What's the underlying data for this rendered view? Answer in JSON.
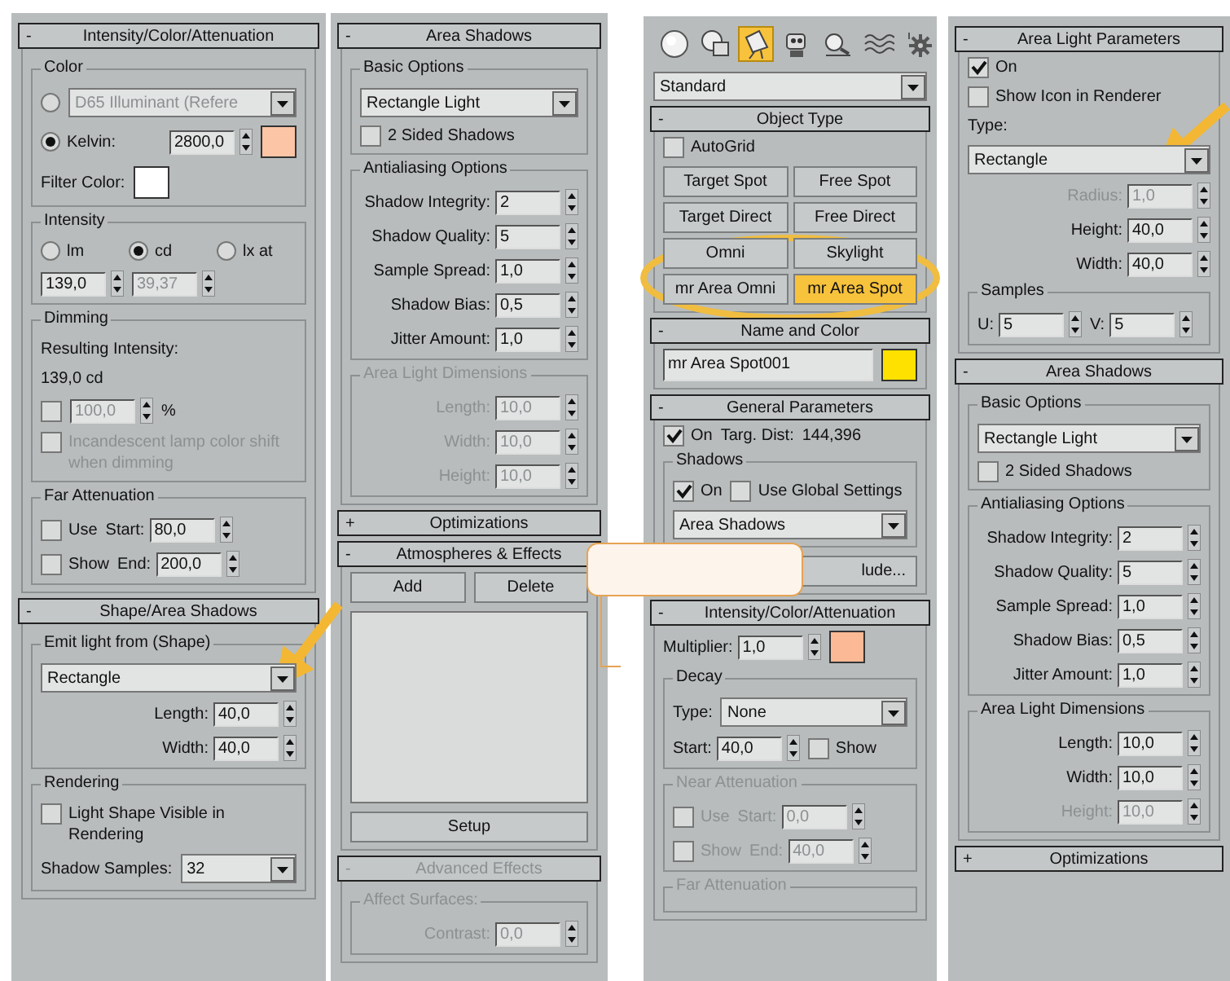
{
  "columns": [
    {
      "items": [
        {
          "kind": "rollout",
          "toggle": "-",
          "title": "Intensity/Color/Attenuation",
          "items": [
            {
              "kind": "group",
              "title": "Color",
              "items": [
                {
                  "kind": "row",
                  "items": [
                    {
                      "kind": "radio",
                      "selected": false,
                      "disabled": true
                    },
                    {
                      "kind": "dropdown",
                      "value": "D65 Illuminant (Refere",
                      "disabled": true
                    }
                  ]
                },
                {
                  "kind": "row",
                  "items": [
                    {
                      "kind": "radio",
                      "label": "Kelvin:",
                      "selected": true
                    },
                    {
                      "kind": "spinner",
                      "value": "2800,0"
                    },
                    {
                      "kind": "color",
                      "color": "#fbc5a6"
                    }
                  ]
                },
                {
                  "kind": "row",
                  "items": [
                    {
                      "kind": "text",
                      "text": "Filter Color:"
                    },
                    {
                      "kind": "color",
                      "color": "#ffffff"
                    }
                  ]
                }
              ]
            },
            {
              "kind": "group",
              "title": "Intensity",
              "items": [
                {
                  "kind": "row",
                  "items": [
                    {
                      "kind": "radio",
                      "label": "lm",
                      "selected": false
                    },
                    {
                      "kind": "radio",
                      "label": "cd",
                      "selected": true
                    },
                    {
                      "kind": "radio",
                      "label": "lx at",
                      "selected": false
                    }
                  ]
                },
                {
                  "kind": "row",
                  "items": [
                    {
                      "kind": "spinner",
                      "value": "139,0"
                    },
                    {
                      "kind": "spinner",
                      "value": "39,37",
                      "disabled": true
                    }
                  ]
                }
              ]
            },
            {
              "kind": "group",
              "title": "Dimming",
              "items": [
                {
                  "kind": "text",
                  "text": "Resulting Intensity:"
                },
                {
                  "kind": "text",
                  "text": "139,0 cd"
                },
                {
                  "kind": "row",
                  "items": [
                    {
                      "kind": "checkbox",
                      "checked": false
                    },
                    {
                      "kind": "spinner",
                      "value": "100,0",
                      "disabled": true
                    },
                    {
                      "kind": "text",
                      "text": "%"
                    }
                  ]
                },
                {
                  "kind": "checkbox",
                  "label": "Incandescent lamp color shift when dimming",
                  "checked": false,
                  "disabled": true
                }
              ]
            },
            {
              "kind": "group",
              "title": "Far Attenuation",
              "items": [
                {
                  "kind": "row",
                  "items": [
                    {
                      "kind": "checkbox",
                      "label": "Use",
                      "checked": false
                    },
                    {
                      "kind": "spinner",
                      "label": "Start:",
                      "value": "80,0"
                    }
                  ]
                },
                {
                  "kind": "row",
                  "items": [
                    {
                      "kind": "checkbox",
                      "label": "Show",
                      "checked": false
                    },
                    {
                      "kind": "spinner",
                      "label": "End:",
                      "value": "200,0"
                    }
                  ]
                }
              ]
            }
          ]
        },
        {
          "kind": "rollout",
          "toggle": "-",
          "title": "Shape/Area Shadows",
          "items": [
            {
              "kind": "group",
              "title": "Emit light from (Shape)",
              "items": [
                {
                  "kind": "dropdown",
                  "value": "Rectangle"
                },
                {
                  "kind": "spinner",
                  "label": "Length:",
                  "value": "40,0"
                },
                {
                  "kind": "spinner",
                  "label": "Width:",
                  "value": "40,0"
                }
              ]
            },
            {
              "kind": "group",
              "title": "Rendering",
              "items": [
                {
                  "kind": "checkbox",
                  "label": "Light Shape Visible in Rendering",
                  "checked": false
                },
                {
                  "kind": "row",
                  "items": [
                    {
                      "kind": "text",
                      "text": "Shadow Samples:"
                    },
                    {
                      "kind": "dropdown",
                      "value": "32"
                    }
                  ]
                }
              ]
            }
          ]
        }
      ]
    },
    {
      "items": [
        {
          "kind": "rollout",
          "toggle": "-",
          "title": "Area Shadows",
          "items": [
            {
              "kind": "group",
              "title": "Basic Options",
              "items": [
                {
                  "kind": "dropdown",
                  "value": "Rectangle Light"
                },
                {
                  "kind": "checkbox",
                  "label": "2 Sided Shadows",
                  "checked": false
                }
              ]
            },
            {
              "kind": "group",
              "title": "Antialiasing Options",
              "items": [
                {
                  "kind": "spinner",
                  "label": "Shadow Integrity:",
                  "value": "2"
                },
                {
                  "kind": "spinner",
                  "label": "Shadow Quality:",
                  "value": "5"
                },
                {
                  "kind": "spacer"
                },
                {
                  "kind": "spinner",
                  "label": "Sample Spread:",
                  "value": "1,0"
                },
                {
                  "kind": "spinner",
                  "label": "Shadow Bias:",
                  "value": "0,5"
                },
                {
                  "kind": "spinner",
                  "label": "Jitter Amount:",
                  "value": "1,0"
                }
              ]
            },
            {
              "kind": "group",
              "title": "Area Light Dimensions",
              "disabled": true,
              "items": [
                {
                  "kind": "spinner",
                  "label": "Length:",
                  "value": "10,0"
                },
                {
                  "kind": "spinner",
                  "label": "Width:",
                  "value": "10,0"
                },
                {
                  "kind": "spinner",
                  "label": "Height:",
                  "value": "10,0"
                }
              ]
            }
          ]
        },
        {
          "kind": "rollout",
          "toggle": "+",
          "title": "Optimizations"
        },
        {
          "kind": "rollout",
          "toggle": "-",
          "title": "Atmospheres & Effects",
          "items": [
            {
              "kind": "row",
              "items": [
                {
                  "kind": "button",
                  "label": "Add",
                  "selected": false
                },
                {
                  "kind": "button",
                  "label": "Delete",
                  "selected": false
                }
              ]
            },
            {
              "kind": "listbox"
            },
            {
              "kind": "button",
              "label": "Setup",
              "selected": false
            }
          ]
        },
        {
          "kind": "rollout",
          "toggle": "-",
          "title": "Advanced Effects",
          "disabled": true,
          "items": [
            {
              "kind": "group",
              "title": "Affect Surfaces:",
              "items": [
                {
                  "kind": "spinner",
                  "label": "Contrast:",
                  "value": "0,0"
                }
              ]
            }
          ]
        }
      ]
    },
    {
      "items": [
        {
          "kind": "toolbar",
          "buttons": [
            {
              "selected": false
            },
            {
              "selected": false
            },
            {
              "selected": true
            },
            {
              "selected": false
            },
            {
              "selected": false
            },
            {
              "selected": false
            },
            {
              "selected": false
            }
          ]
        },
        {
          "kind": "dropdown",
          "value": "Standard"
        },
        {
          "kind": "rollout",
          "toggle": "-",
          "title": "Object Type",
          "items": [
            {
              "kind": "checkbox",
              "label": "AutoGrid",
              "checked": false
            },
            {
              "kind": "grid",
              "items": [
                {
                  "kind": "button",
                  "label": "Target Spot",
                  "selected": false
                },
                {
                  "kind": "button",
                  "label": "Free Spot",
                  "selected": false
                },
                {
                  "kind": "button",
                  "label": "Target Direct",
                  "selected": false
                },
                {
                  "kind": "button",
                  "label": "Free Direct",
                  "selected": false
                },
                {
                  "kind": "button",
                  "label": "Omni",
                  "selected": false
                },
                {
                  "kind": "button",
                  "label": "Skylight",
                  "selected": false
                },
                {
                  "kind": "button",
                  "label": "mr Area Omni",
                  "selected": false
                },
                {
                  "kind": "button",
                  "label": "mr Area Spot",
                  "selected": true
                }
              ]
            }
          ]
        },
        {
          "kind": "rollout",
          "toggle": "-",
          "title": "Name and Color",
          "items": [
            {
              "kind": "row",
              "items": [
                {
                  "kind": "input",
                  "value": "mr Area Spot001"
                },
                {
                  "kind": "color",
                  "color": "#ffe100"
                }
              ]
            }
          ]
        },
        {
          "kind": "rollout",
          "toggle": "-",
          "title": "General Parameters",
          "items": [
            {
              "kind": "row",
              "items": [
                {
                  "kind": "checkbox",
                  "label": "On",
                  "checked": true
                },
                {
                  "kind": "text",
                  "text": "Targ. Dist:"
                },
                {
                  "kind": "text",
                  "text": "144,396"
                }
              ]
            },
            {
              "kind": "group",
              "title": "Shadows",
              "items": [
                {
                  "kind": "row",
                  "items": [
                    {
                      "kind": "checkbox",
                      "label": "On",
                      "checked": true
                    },
                    {
                      "kind": "checkbox",
                      "label": "Use Global Settings",
                      "checked": false
                    }
                  ]
                },
                {
                  "kind": "dropdown",
                  "value": "Area Shadows"
                }
              ]
            },
            {
              "kind": "button",
              "label": "lude...",
              "selected": false
            }
          ]
        },
        {
          "kind": "rollout",
          "toggle": "-",
          "title": "Intensity/Color/Attenuation",
          "items": [
            {
              "kind": "row",
              "items": [
                {
                  "kind": "spinner",
                  "label": "Multiplier:",
                  "value": "1,0"
                },
                {
                  "kind": "color",
                  "color": "#fbb995"
                }
              ]
            },
            {
              "kind": "group",
              "title": "Decay",
              "items": [
                {
                  "kind": "row",
                  "items": [
                    {
                      "kind": "text",
                      "text": "Type:"
                    },
                    {
                      "kind": "dropdown",
                      "value": "None"
                    }
                  ]
                },
                {
                  "kind": "row",
                  "items": [
                    {
                      "kind": "spinner",
                      "label": "Start:",
                      "value": "40,0"
                    },
                    {
                      "kind": "checkbox",
                      "label": "Show",
                      "checked": false
                    }
                  ]
                }
              ]
            },
            {
              "kind": "group",
              "title": "Near Attenuation",
              "disabled": true,
              "items": [
                {
                  "kind": "row",
                  "items": [
                    {
                      "kind": "checkbox",
                      "label": "Use",
                      "checked": false
                    },
                    {
                      "kind": "spinner",
                      "label": "Start:",
                      "value": "0,0"
                    }
                  ]
                },
                {
                  "kind": "row",
                  "items": [
                    {
                      "kind": "checkbox",
                      "label": "Show",
                      "checked": false
                    },
                    {
                      "kind": "spinner",
                      "label": "End:",
                      "value": "40,0"
                    }
                  ]
                }
              ]
            },
            {
              "kind": "group",
              "title": "Far Attenuation",
              "disabled": true
            }
          ]
        }
      ]
    },
    {
      "items": [
        {
          "kind": "rollout",
          "toggle": "-",
          "title": "Area Light Parameters",
          "items": [
            {
              "kind": "checkbox",
              "label": "On",
              "checked": true
            },
            {
              "kind": "checkbox",
              "label": "Show Icon in Renderer",
              "checked": false
            },
            {
              "kind": "text",
              "text": "Type:"
            },
            {
              "kind": "dropdown",
              "value": "Rectangle"
            },
            {
              "kind": "spinner",
              "label": "Radius:",
              "value": "1,0",
              "disabled": true
            },
            {
              "kind": "spinner",
              "label": "Height:",
              "value": "40,0"
            },
            {
              "kind": "spinner",
              "label": "Width:",
              "value": "40,0"
            },
            {
              "kind": "group",
              "title": "Samples",
              "items": [
                {
                  "kind": "row",
                  "items": [
                    {
                      "kind": "spinner",
                      "label": "U:",
                      "value": "5"
                    },
                    {
                      "kind": "spinner",
                      "label": "V:",
                      "value": "5"
                    }
                  ]
                }
              ]
            }
          ]
        },
        {
          "kind": "rollout",
          "toggle": "-",
          "title": "Area Shadows",
          "items": [
            {
              "kind": "group",
              "title": "Basic Options",
              "items": [
                {
                  "kind": "dropdown",
                  "value": "Rectangle Light"
                },
                {
                  "kind": "checkbox",
                  "label": "2 Sided Shadows",
                  "checked": false
                }
              ]
            },
            {
              "kind": "group",
              "title": "Antialiasing Options",
              "items": [
                {
                  "kind": "spinner",
                  "label": "Shadow Integrity:",
                  "value": "2"
                },
                {
                  "kind": "spinner",
                  "label": "Shadow Quality:",
                  "value": "5"
                },
                {
                  "kind": "spacer"
                },
                {
                  "kind": "spinner",
                  "label": "Sample Spread:",
                  "value": "1,0"
                },
                {
                  "kind": "spinner",
                  "label": "Shadow Bias:",
                  "value": "0,5"
                },
                {
                  "kind": "spinner",
                  "label": "Jitter Amount:",
                  "value": "1,0"
                }
              ]
            },
            {
              "kind": "group",
              "title": "Area Light Dimensions",
              "items": [
                {
                  "kind": "spinner",
                  "label": "Length:",
                  "value": "10,0"
                },
                {
                  "kind": "spinner",
                  "label": "Width:",
                  "value": "10,0"
                },
                {
                  "kind": "spinner",
                  "label": "Height:",
                  "value": "10,0",
                  "disabled": true
                }
              ]
            }
          ]
        },
        {
          "kind": "rollout",
          "toggle": "+",
          "title": "Optimizations"
        }
      ]
    }
  ]
}
